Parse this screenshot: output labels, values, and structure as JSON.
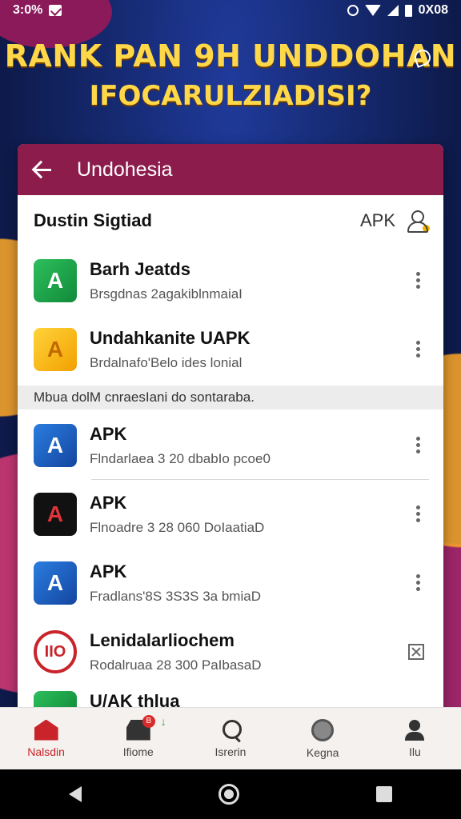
{
  "status_bar": {
    "time": "3:0%",
    "right_text": "0X08",
    "icons": [
      "mail-icon",
      "alarm-icon",
      "wifi-icon",
      "signal-icon",
      "battery-icon"
    ]
  },
  "banner": {
    "line1": "RANK PAN 9H UNDDOHAN",
    "line2": "IFOCARULZIADISI?",
    "icon": "pin-icon"
  },
  "app_bar": {
    "title": "Undohesia",
    "back_icon": "back-arrow-icon",
    "color": "#8c1c4c"
  },
  "section": {
    "title": "Dustin Sigtiad",
    "right_label": "APK",
    "icon": "user-icon"
  },
  "top_items": [
    {
      "title": "Barh Jeatds",
      "subtitle": "Brsgdnas 2agakiblnmaiaI",
      "icon": "green-app-icon",
      "glyph": "A"
    },
    {
      "title": "Undahkanite UAPK",
      "subtitle": "Brdalnafo'Belo ides lonial",
      "icon": "yellow-app-icon",
      "glyph": "A"
    }
  ],
  "subheader": "Mbua dolM cnraesIani do sontaraba.",
  "bottom_items": [
    {
      "title": "APK",
      "subtitle": "Flndarlaea 3 20 dbabIo pcoe0",
      "icon": "blue-app-icon",
      "glyph": "A"
    },
    {
      "title": "APK",
      "subtitle": "Flnoadre 3 28 060 DoIaatiaD",
      "icon": "dark-app-icon",
      "glyph": "A"
    },
    {
      "title": "APK",
      "subtitle": "Fradlans'8S 3S3S 3a bmiaD",
      "icon": "blue-app-icon",
      "glyph": "A"
    },
    {
      "title": "Lenidalarliochem",
      "subtitle": "Rodalruaa 28 300 PaIbasaD",
      "icon": "round-app-icon",
      "glyph": "IIO"
    }
  ],
  "partial_item": {
    "title": "U/AK thlua"
  },
  "bottom_nav": [
    {
      "label": "Nalsdin",
      "icon": "home-icon",
      "active": true
    },
    {
      "label": "Ifiome",
      "icon": "store-icon",
      "active": false,
      "badge": "B",
      "arrow": "↓"
    },
    {
      "label": "Isrerin",
      "icon": "search-user-icon",
      "active": false
    },
    {
      "label": "Kegna",
      "icon": "globe-icon",
      "active": false
    },
    {
      "label": "Ilu",
      "icon": "person-icon",
      "active": false
    }
  ],
  "system_nav": [
    "back-icon",
    "home-circle-icon",
    "recents-icon"
  ]
}
